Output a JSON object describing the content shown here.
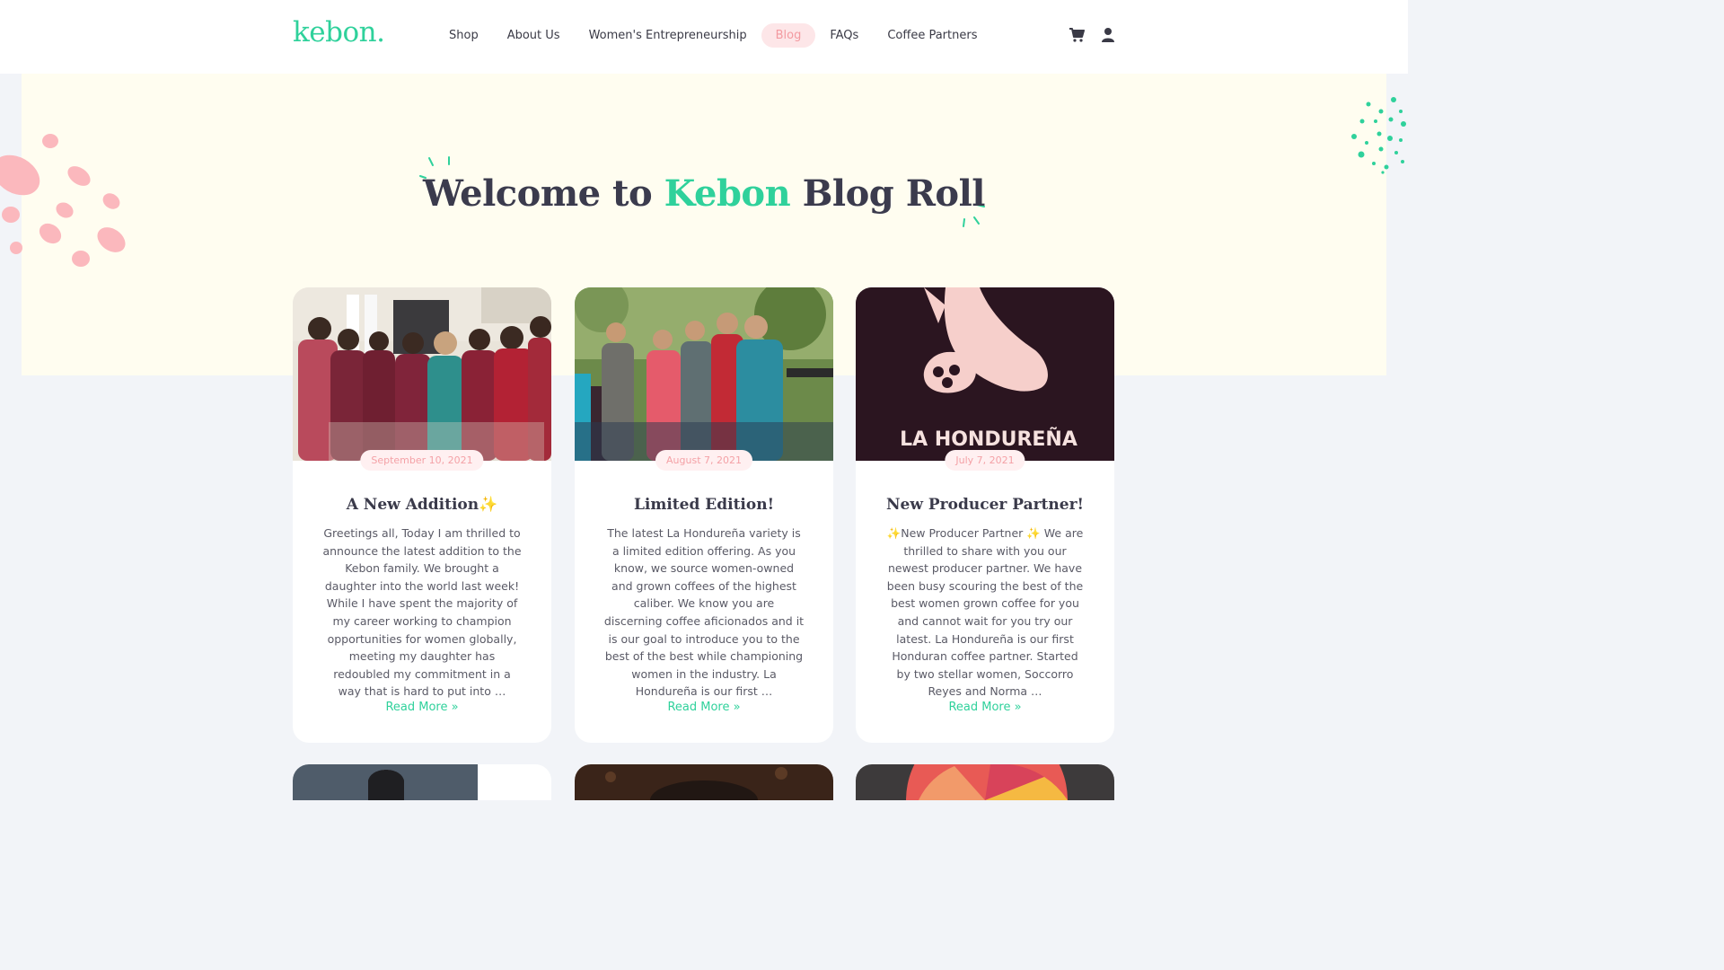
{
  "header": {
    "logo": "kebon.",
    "nav": [
      {
        "label": "Shop",
        "active": false
      },
      {
        "label": "About Us",
        "active": false
      },
      {
        "label": "Women's Entrepreneurship",
        "active": false
      },
      {
        "label": "Blog",
        "active": true
      },
      {
        "label": "FAQs",
        "active": false
      },
      {
        "label": "Coffee Partners",
        "active": false
      }
    ],
    "icons": [
      "cart-icon",
      "user-icon"
    ]
  },
  "hero": {
    "title_before": "Welcome to ",
    "title_accent": "Kebon",
    "title_after": " Blog Roll"
  },
  "posts": [
    {
      "date": "September 10, 2021",
      "title": "A New Addition✨",
      "excerpt": "Greetings all, Today I am thrilled to announce the latest addition to the Kebon family. We brought a daughter into the world last week! While I have spent the majority of my career working to champion opportunities for women globally, meeting my daughter has redoubled my commitment in a way that is hard to put into …",
      "read_more": "Read More »",
      "image": "group-of-schoolchildren-photo"
    },
    {
      "date": "August 7, 2021",
      "title": "Limited Edition!",
      "excerpt": "The latest La Hondureña variety is a limited edition offering. As you know, we source women-owned and grown coffees of the highest caliber. We know you are discerning coffee aficionados and it is our goal to introduce you to the best of the best while championing women in the industry.  La Hondureña is our first …",
      "read_more": "Read More »",
      "image": "coffee-producers-group-photo"
    },
    {
      "date": "July 7, 2021",
      "title": "New Producer Partner!",
      "excerpt": "✨New Producer Partner ✨ We are thrilled to share with you our newest producer partner. We have been busy scouring the best of the best women grown coffee for you and cannot wait for you try our latest. La Hondureña is our first Honduran coffee partner. Started by two stellar women, Soccorro Reyes and Norma …",
      "read_more": "Read More »",
      "image": "la-hondurena-logo",
      "image_text": "LA HONDUREÑA"
    }
  ],
  "colors": {
    "accent": "#2fd19b",
    "pink": "#f4a1a6",
    "hero_bg": "#fffdf0",
    "page_bg": "#f2f4f8",
    "text": "#3b3b4d"
  }
}
